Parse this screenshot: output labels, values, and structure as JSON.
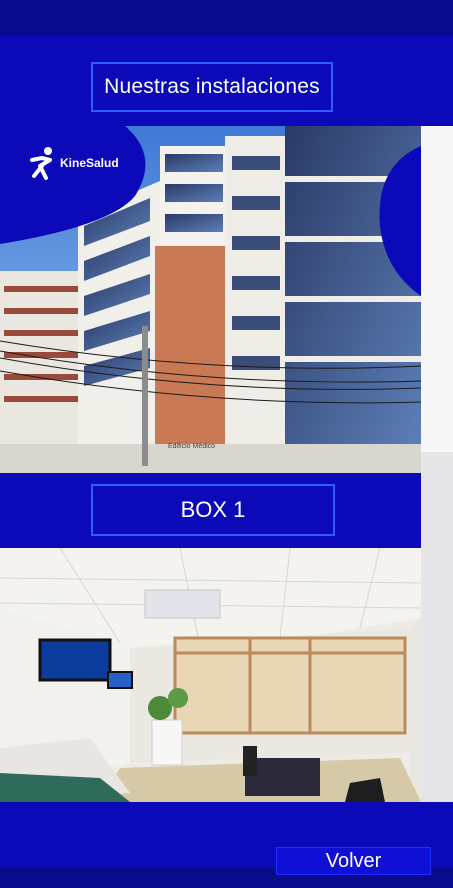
{
  "header": {
    "title": "Nuestras instalaciones"
  },
  "hero_image": {
    "logo_text": "KineSalud",
    "sign_text": "Edificio Médico"
  },
  "box": {
    "title": "BOX 1"
  },
  "footer": {
    "back_label": "Volver"
  },
  "colors": {
    "primary": "#0c0ab8",
    "dark": "#0a0a8c",
    "border": "#2f5bff"
  }
}
